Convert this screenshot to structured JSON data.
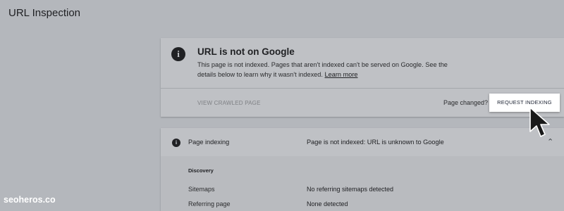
{
  "header": {
    "title": "URL Inspection"
  },
  "status_card": {
    "title": "URL is not on Google",
    "description": "This page is not indexed. Pages that aren't indexed can't be served on Google. See the details below to learn why it wasn't indexed.",
    "learn_more": "Learn more",
    "view_crawled_label": "VIEW CRAWLED PAGE",
    "page_changed_label": "Page changed?",
    "request_indexing_label": "REQUEST INDEXING"
  },
  "indexing_card": {
    "label": "Page indexing",
    "status": "Page is not indexed: URL is unknown to Google",
    "section_heading": "Discovery",
    "rows": [
      {
        "label": "Sitemaps",
        "value": "No referring sitemaps detected"
      },
      {
        "label": "Referring page",
        "value": "None detected"
      }
    ]
  },
  "watermark": "seoheros.co",
  "icons": {
    "status": "info-icon",
    "indexing": "info-icon",
    "collapse": "chevron-up-icon",
    "pointer": "cursor-arrow-icon"
  },
  "colors": {
    "background": "#b4b7bc",
    "card": "#bfc1c5",
    "button": "#ffffff",
    "text": "#202124"
  }
}
